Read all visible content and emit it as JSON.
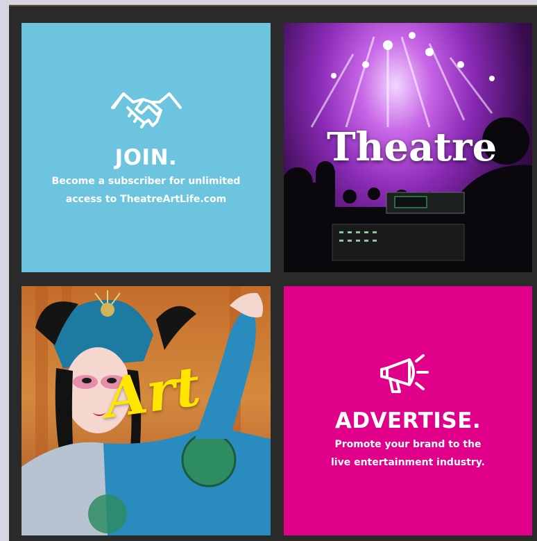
{
  "tiles": {
    "join": {
      "title": "JOIN.",
      "line1": "Become a subscriber for unlimited",
      "line2": "access to TheatreArtLife.com",
      "color": "#6cc4de",
      "icon": "handshake-icon"
    },
    "theatre": {
      "word": "Theatre",
      "image": "concert-stage-photo"
    },
    "art": {
      "word": "Art",
      "image": "opera-performer-photo"
    },
    "advertise": {
      "title": "ADVERTISE.",
      "line1": "Promote your brand to the",
      "line2": "live entertainment industry.",
      "color": "#e0008a",
      "icon": "megaphone-icon"
    }
  }
}
